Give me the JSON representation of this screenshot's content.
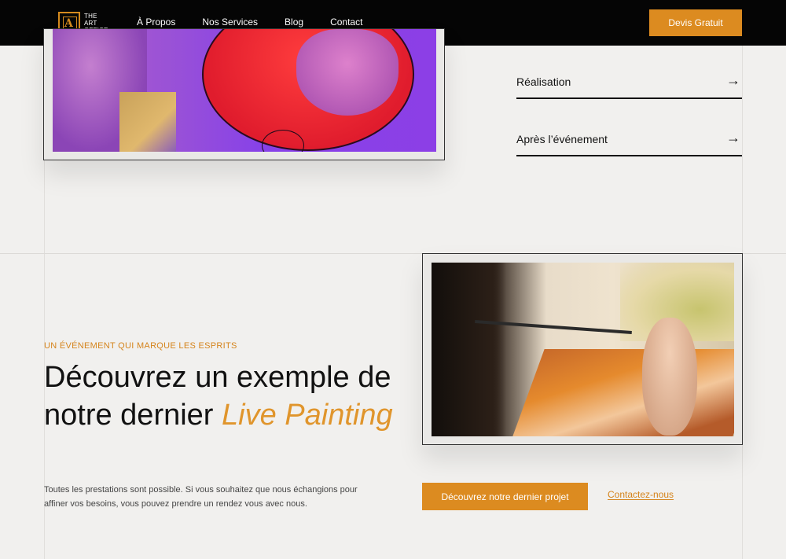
{
  "header": {
    "logo_lines": [
      "THE",
      "ART",
      "OFFICE"
    ],
    "nav": [
      {
        "label": "À Propos"
      },
      {
        "label": "Nos Services"
      },
      {
        "label": "Blog"
      },
      {
        "label": "Contact"
      }
    ],
    "cta_label": "Devis Gratuit"
  },
  "accordion": [
    {
      "label": "Réalisation"
    },
    {
      "label": "Après l’événement"
    }
  ],
  "section": {
    "eyebrow": "UN ÉVÉNEMENT QUI MARQUE LES ESPRITS",
    "headline_main": "Découvrez un exemple de notre dernier ",
    "headline_accent": "Live Painting",
    "body": "Toutes les prestations sont possible. Si vous souhaitez que nous échangions pour affiner vos besoins, vous pouvez prendre un rendez vous avec nous.",
    "primary_button": "Découvrez notre dernier projet",
    "secondary_link": "Contactez-nous"
  },
  "colors": {
    "accent": "#dc8b20",
    "header_bg": "#050505",
    "page_bg": "#f1f0ee"
  }
}
